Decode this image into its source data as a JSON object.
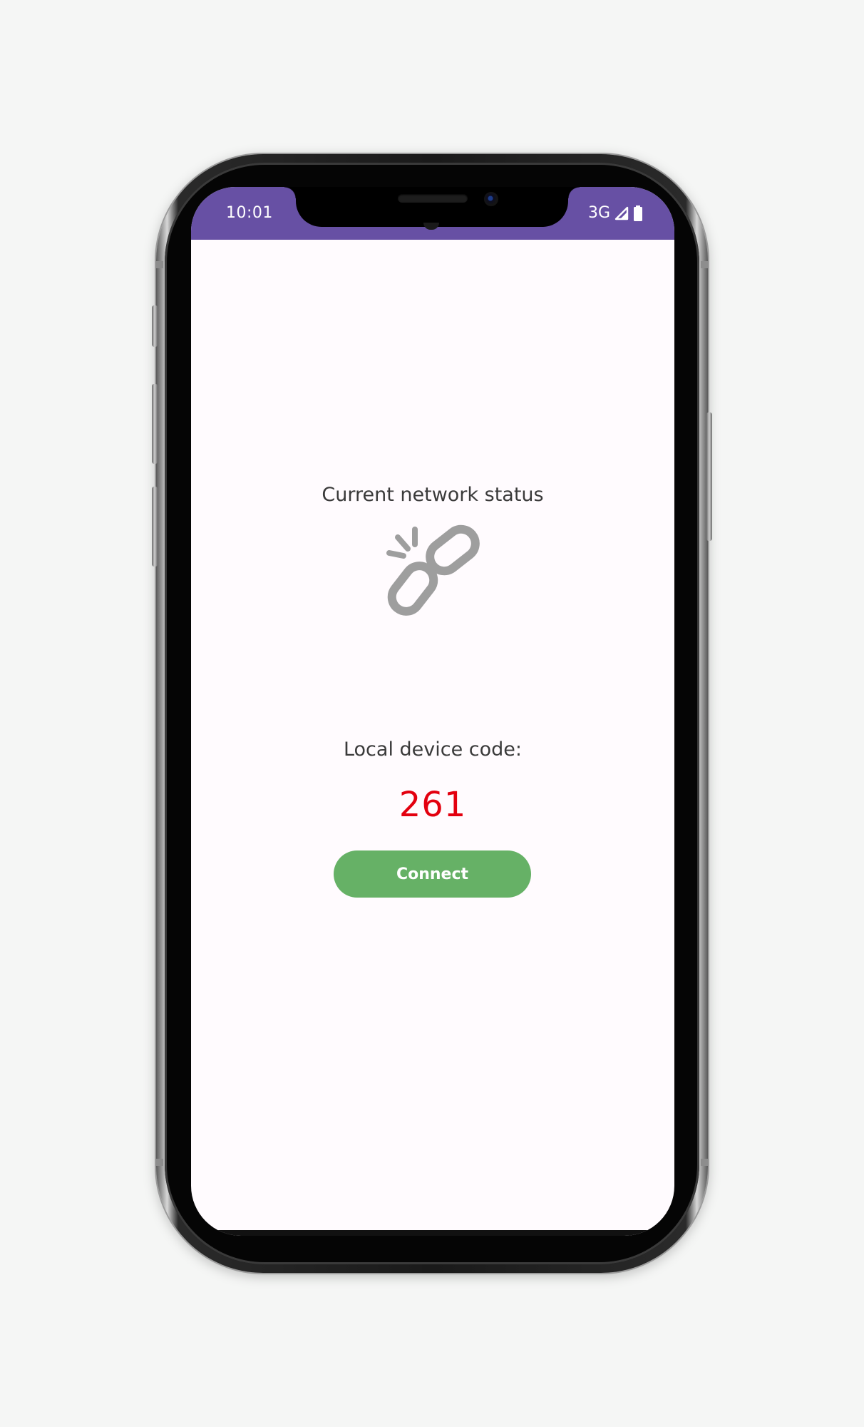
{
  "status_bar": {
    "time": "10:01",
    "network": "3G",
    "background_color": "#6750a4",
    "icons": [
      "signal-icon",
      "battery-icon"
    ]
  },
  "main": {
    "network_status_label": "Current network status",
    "network_status_icon": "broken-link-icon",
    "device_code_label": "Local device code:",
    "device_code": "261",
    "device_code_color": "#e3000f",
    "connect_label": "Connect",
    "connect_color": "#66b166"
  }
}
